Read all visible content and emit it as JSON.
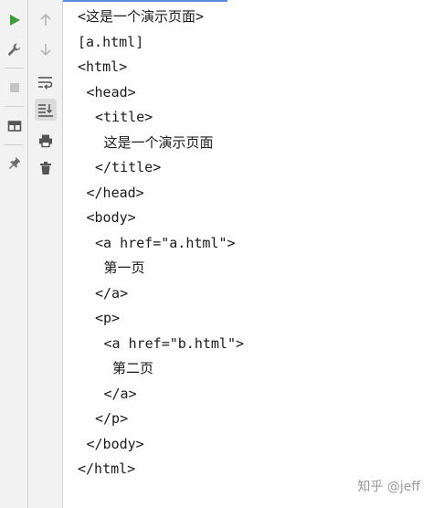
{
  "toolbar_left": {
    "items": [
      {
        "name": "run-icon"
      },
      {
        "name": "wrench-icon"
      },
      {
        "name": "stop-icon"
      },
      {
        "name": "layout-icon"
      },
      {
        "name": "pin-icon"
      }
    ]
  },
  "toolbar_right": {
    "items": [
      {
        "name": "arrow-up-icon"
      },
      {
        "name": "arrow-down-icon"
      },
      {
        "name": "soft-wrap-icon"
      },
      {
        "name": "scroll-to-end-icon"
      },
      {
        "name": "print-icon"
      },
      {
        "name": "trash-icon"
      }
    ]
  },
  "console": {
    "lines": [
      {
        "indent": 0,
        "text": "<这是一个演示页面>"
      },
      {
        "indent": 0,
        "text": "[a.html]"
      },
      {
        "indent": 0,
        "text": "<html>"
      },
      {
        "indent": 1,
        "text": "<head>"
      },
      {
        "indent": 2,
        "text": "<title>"
      },
      {
        "indent": 3,
        "text": "这是一个演示页面"
      },
      {
        "indent": 2,
        "text": "</title>"
      },
      {
        "indent": 1,
        "text": "</head>"
      },
      {
        "indent": 1,
        "text": "<body>"
      },
      {
        "indent": 2,
        "text": "<a href=\"a.html\">"
      },
      {
        "indent": 3,
        "text": "第一页"
      },
      {
        "indent": 2,
        "text": "</a>"
      },
      {
        "indent": 2,
        "text": "<p>"
      },
      {
        "indent": 3,
        "text": "<a href=\"b.html\">"
      },
      {
        "indent": 4,
        "text": "第二页"
      },
      {
        "indent": 3,
        "text": "</a>"
      },
      {
        "indent": 2,
        "text": "</p>"
      },
      {
        "indent": 1,
        "text": "</body>"
      },
      {
        "indent": 0,
        "text": "</html>"
      }
    ]
  },
  "watermark": "知乎 @jeff",
  "colors": {
    "run_green": "#3e9b3e",
    "icon_gray": "#6e6e6e",
    "icon_disabled": "#b5b5b5",
    "accent_blue": "#5b8bd6"
  }
}
